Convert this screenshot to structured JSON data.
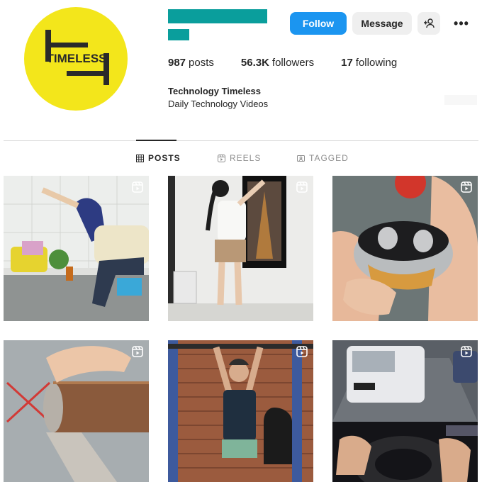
{
  "profile": {
    "avatar_logo_text": "TIMELESS",
    "bio_name": "Technology Timeless",
    "bio_description": "Daily Technology Videos"
  },
  "actions": {
    "follow_label": "Follow",
    "message_label": "Message",
    "add_user_icon": "add-user-icon",
    "more_label": "•••"
  },
  "stats": {
    "posts_count": "987",
    "posts_label": "posts",
    "followers_count": "56.3K",
    "followers_label": "followers",
    "following_count": "17",
    "following_label": "following"
  },
  "tabs": [
    {
      "label": "POSTS",
      "icon": "grid-icon",
      "active": true
    },
    {
      "label": "REELS",
      "icon": "reels-icon",
      "active": false
    },
    {
      "label": "TAGGED",
      "icon": "tagged-icon",
      "active": false
    }
  ],
  "posts": [
    {
      "subject": "man mounting wall organizer",
      "type": "reel"
    },
    {
      "subject": "woman hanging Eiffel tower frame",
      "type": "reel"
    },
    {
      "subject": "wireless earbuds in case",
      "type": "reel"
    },
    {
      "subject": "rusty pipe close-up",
      "type": "reel"
    },
    {
      "subject": "woman on pull-up bar",
      "type": "reel"
    },
    {
      "subject": "van and steering wheel simulator",
      "type": "reel"
    }
  ],
  "colors": {
    "accent": "#1b95f0",
    "avatar_bg": "#f3e61b",
    "redaction": "#0a9e9c"
  }
}
